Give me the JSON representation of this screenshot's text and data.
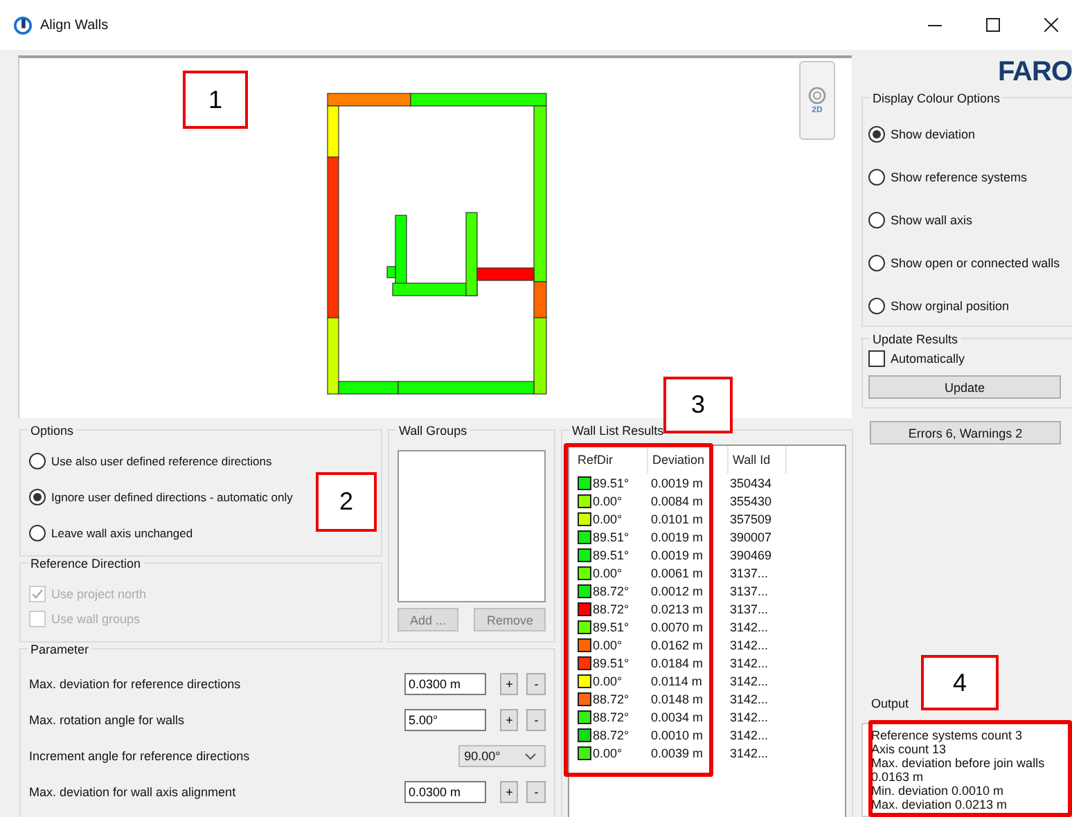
{
  "window": {
    "title": "Align Walls"
  },
  "logo": "FARO",
  "canvas": {
    "view_mode": "2D"
  },
  "callouts": [
    {
      "label": "1"
    },
    {
      "label": "2"
    },
    {
      "label": "3"
    },
    {
      "label": "4"
    }
  ],
  "options": {
    "title": "Options",
    "items": [
      {
        "label": "Use also user defined reference directions",
        "selected": false
      },
      {
        "label": "Ignore user defined directions - automatic only",
        "selected": true
      },
      {
        "label": "Leave wall axis unchanged",
        "selected": false
      }
    ]
  },
  "reference_direction": {
    "title": "Reference Direction",
    "items": [
      {
        "label": "Use project north",
        "checked": true,
        "disabled": true
      },
      {
        "label": "Use wall groups",
        "checked": false,
        "disabled": true
      }
    ]
  },
  "wall_groups": {
    "title": "Wall Groups",
    "buttons": [
      {
        "label": "Add ...",
        "disabled": true
      },
      {
        "label": "Remove",
        "disabled": true
      }
    ]
  },
  "parameter": {
    "title": "Parameter",
    "rows": [
      {
        "kind": "spin",
        "label": "Max. deviation for reference directions",
        "value": "0.0300 m",
        "plus": "+",
        "minus": "-"
      },
      {
        "kind": "spin",
        "label": "Max. rotation angle for walls",
        "value": "5.00°",
        "plus": "+",
        "minus": "-"
      },
      {
        "kind": "dropdown",
        "label": "Increment angle for reference directions",
        "value": "90.00°"
      },
      {
        "kind": "spin",
        "label": "Max. deviation for wall axis alignment",
        "value": "0.0300 m",
        "plus": "+",
        "minus": "-"
      }
    ]
  },
  "wall_list": {
    "title": "Wall List Results",
    "columns": [
      "RefDir",
      "Deviation",
      "Wall Id"
    ],
    "rows": [
      {
        "color": "#11ee11",
        "ref_dir": "89.51°",
        "deviation": "0.0019 m",
        "wall_id": "350434"
      },
      {
        "color": "#99ff00",
        "ref_dir": "0.00°",
        "deviation": "0.0084 m",
        "wall_id": "355430"
      },
      {
        "color": "#ccff00",
        "ref_dir": "0.00°",
        "deviation": "0.0101 m",
        "wall_id": "357509"
      },
      {
        "color": "#11ee11",
        "ref_dir": "89.51°",
        "deviation": "0.0019 m",
        "wall_id": "390007"
      },
      {
        "color": "#11ee11",
        "ref_dir": "89.51°",
        "deviation": "0.0019 m",
        "wall_id": "390469"
      },
      {
        "color": "#66ff00",
        "ref_dir": "0.00°",
        "deviation": "0.0061 m",
        "wall_id": "3137..."
      },
      {
        "color": "#11ee11",
        "ref_dir": "88.72°",
        "deviation": "0.0012 m",
        "wall_id": "3137..."
      },
      {
        "color": "#ff0000",
        "ref_dir": "88.72°",
        "deviation": "0.0213 m",
        "wall_id": "3137..."
      },
      {
        "color": "#66ff00",
        "ref_dir": "89.51°",
        "deviation": "0.0070 m",
        "wall_id": "3142..."
      },
      {
        "color": "#ff6600",
        "ref_dir": "0.00°",
        "deviation": "0.0162 m",
        "wall_id": "3142..."
      },
      {
        "color": "#ff3300",
        "ref_dir": "89.51°",
        "deviation": "0.0184 m",
        "wall_id": "3142..."
      },
      {
        "color": "#ffff00",
        "ref_dir": "0.00°",
        "deviation": "0.0114 m",
        "wall_id": "3142..."
      },
      {
        "color": "#ff6611",
        "ref_dir": "88.72°",
        "deviation": "0.0148 m",
        "wall_id": "3142..."
      },
      {
        "color": "#33ee11",
        "ref_dir": "88.72°",
        "deviation": "0.0034 m",
        "wall_id": "3142..."
      },
      {
        "color": "#11dd11",
        "ref_dir": "88.72°",
        "deviation": "0.0010 m",
        "wall_id": "3142..."
      },
      {
        "color": "#44ee11",
        "ref_dir": "0.00°",
        "deviation": "0.0039 m",
        "wall_id": "3142..."
      }
    ]
  },
  "display_colour_options": {
    "title": "Display Colour Options",
    "items": [
      {
        "label": "Show deviation",
        "selected": true
      },
      {
        "label": "Show reference systems",
        "selected": false
      },
      {
        "label": "Show wall axis",
        "selected": false
      },
      {
        "label": "Show open or connected walls",
        "selected": false
      },
      {
        "label": "Show orginal position",
        "selected": false
      }
    ]
  },
  "update_results": {
    "title": "Update Results",
    "automatic": {
      "label": "Automatically",
      "checked": false
    },
    "button": "Update"
  },
  "status_button": "Errors 6, Warnings 2",
  "output": {
    "title": "Output",
    "lines": [
      "Reference systems count 3",
      "Axis count 13",
      "Max. deviation before join walls",
      "0.0163 m",
      "Min. deviation 0.0010 m",
      "Max. deviation 0.0213 m"
    ]
  }
}
